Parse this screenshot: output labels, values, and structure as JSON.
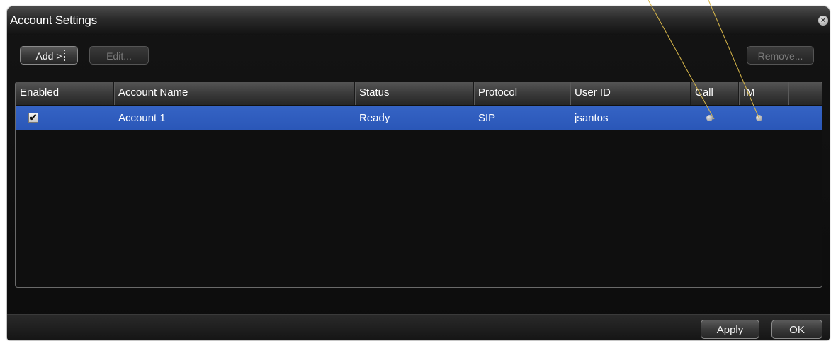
{
  "window": {
    "title": "Account Settings",
    "close_icon": "close-icon"
  },
  "toolbar": {
    "add_label": "Add >",
    "edit_label": "Edit...",
    "remove_label": "Remove..."
  },
  "table": {
    "columns": [
      "Enabled",
      "Account Name",
      "Status",
      "Protocol",
      "User ID",
      "Call",
      "IM"
    ],
    "rows": [
      {
        "enabled": true,
        "enabled_icon": "checkmark-icon",
        "account_name": "Account 1",
        "status": "Ready",
        "protocol": "SIP",
        "user_id": "jsantos",
        "call_indicator": "status-dot-icon",
        "im_indicator": "status-dot-icon"
      }
    ]
  },
  "footer": {
    "apply_label": "Apply",
    "ok_label": "OK"
  },
  "colors": {
    "selection": "#2f5ec0",
    "window_bg": "#0f0f0f",
    "annotation_line": "#d9b84a"
  }
}
